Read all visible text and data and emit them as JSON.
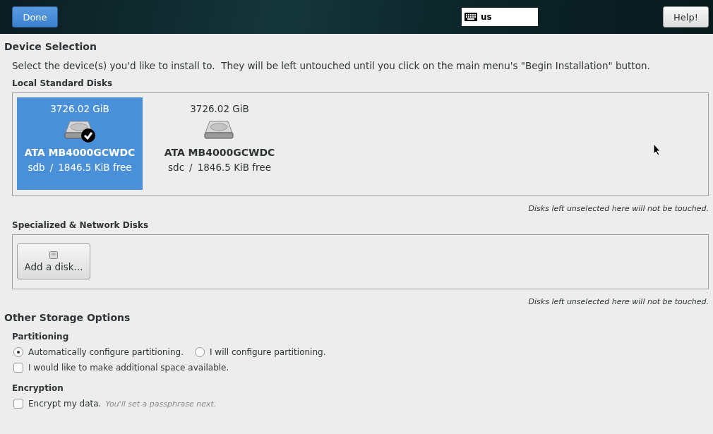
{
  "header": {
    "done_button": "Done",
    "keyboard_layout": "us",
    "help_button": "Help!"
  },
  "device_selection": {
    "title": "Device Selection",
    "description": "Select the device(s) you'd like to install to.  They will be left untouched until you click on the main menu's \"Begin Installation\" button.",
    "local_disks": {
      "title": "Local Standard Disks",
      "disks": [
        {
          "size": "3726.02 GiB",
          "name": "ATA MB4000GCWDC",
          "device": "sdb",
          "separator": "/",
          "free": "1846.5 KiB free",
          "selected": true
        },
        {
          "size": "3726.02 GiB",
          "name": "ATA MB4000GCWDC",
          "device": "sdc",
          "separator": "/",
          "free": "1846.5 KiB free",
          "selected": false
        }
      ],
      "note": "Disks left unselected here will not be touched."
    },
    "network_disks": {
      "title": "Specialized & Network Disks",
      "add_button": "Add a disk...",
      "note": "Disks left unselected here will not be touched."
    }
  },
  "other_storage": {
    "title": "Other Storage Options",
    "partitioning": {
      "title": "Partitioning",
      "options": [
        {
          "label": "Automatically configure partitioning.",
          "selected": true
        },
        {
          "label": "I will configure partitioning.",
          "selected": false
        }
      ],
      "extra_space": {
        "label": "I would like to make additional space available.",
        "checked": false
      }
    },
    "encryption": {
      "title": "Encryption",
      "label": "Encrypt my data.",
      "hint": "You'll set a passphrase next.",
      "checked": false
    }
  }
}
